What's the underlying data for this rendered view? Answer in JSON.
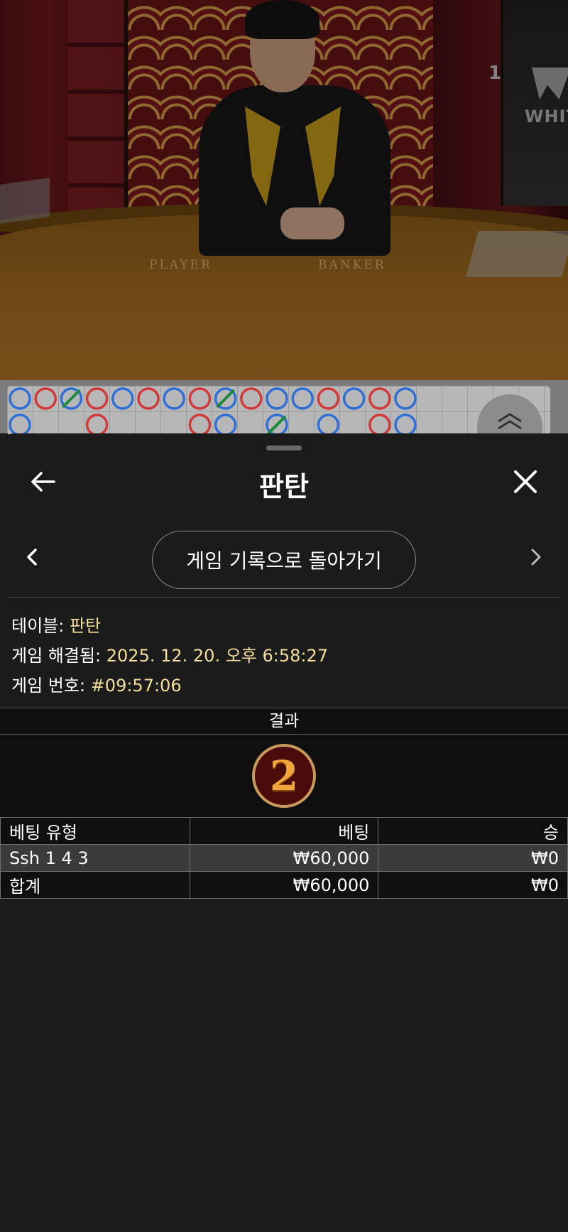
{
  "video": {
    "table_label_player": "PLAYER",
    "table_label_banker": "BANKER",
    "monitor_brand": "WHITE",
    "monitor_number": "1"
  },
  "roadmap": {
    "row1": [
      "B",
      "P",
      "T",
      "P",
      "B",
      "P",
      "B",
      "P",
      "T",
      "P",
      "B",
      "B",
      "P",
      "B",
      "P",
      "B"
    ],
    "row2": [
      "B",
      "",
      "",
      "P",
      "",
      "",
      "",
      "P",
      "B",
      "",
      "T",
      "",
      "B",
      "",
      "P",
      "B"
    ]
  },
  "sheet": {
    "title": "판탄",
    "back_to_history_label": "게임 기록으로 돌아가기",
    "info": {
      "table_label": "테이블:",
      "table_value": "판탄",
      "resolved_label": "게임 해결됨:",
      "resolved_value": "2025. 12. 20. 오후 6:58:27",
      "game_number_label": "게임 번호:",
      "game_number_value": "#09:57:06"
    },
    "result_header": "결과",
    "result_value": "2",
    "bets_table": {
      "headers": [
        "베팅 유형",
        "베팅",
        "승"
      ],
      "rows": [
        {
          "type": "Ssh 1 4 3",
          "bet": "₩60,000",
          "win": "₩0"
        },
        {
          "type": "합계",
          "bet": "₩60,000",
          "win": "₩0"
        }
      ]
    }
  },
  "colors": {
    "player": "#2f6fd6",
    "banker": "#d23a3a",
    "tie": "#1f8a3a",
    "info_value": "#f2df9c",
    "sheet_bg": "#1b1b1b"
  }
}
